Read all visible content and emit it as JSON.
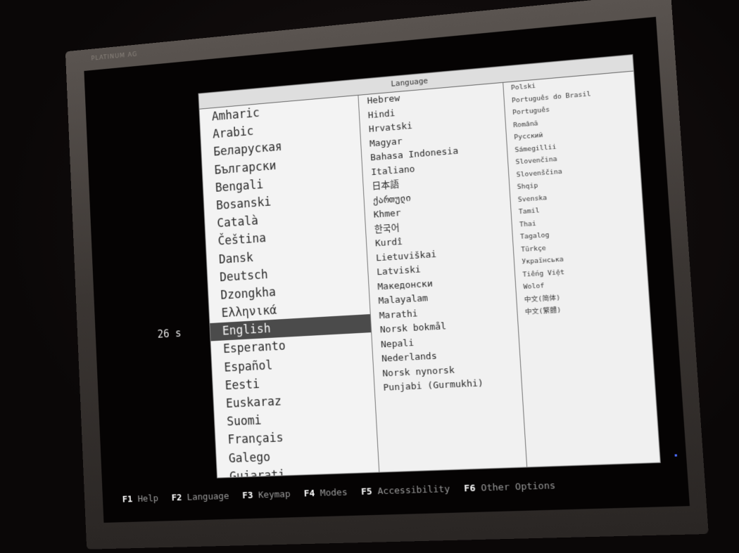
{
  "monitor": {
    "brand": "PLATINUM AG"
  },
  "boot": {
    "timer": "26 s"
  },
  "dialog": {
    "title": "Language",
    "columns": [
      [
        "Amharic",
        "Arabic",
        "Беларуская",
        "Български",
        "Bengali",
        "Bosanski",
        "Català",
        "Čeština",
        "Dansk",
        "Deutsch",
        "Dzongkha",
        "Ελληνικά",
        "English",
        "Esperanto",
        "Español",
        "Eesti",
        "Euskaraz",
        "Suomi",
        "Français",
        "Galego",
        "Gujarati"
      ],
      [
        "Hebrew",
        "Hindi",
        "Hrvatski",
        "Magyar",
        "Bahasa Indonesia",
        "Italiano",
        "日本語",
        "ქართული",
        "Khmer",
        "한국어",
        "Kurdî",
        "Lietuviškai",
        "Latviski",
        "Македонски",
        "Malayalam",
        "Marathi",
        "Norsk bokmål",
        "Nepali",
        "Nederlands",
        "Norsk nynorsk",
        "Punjabi (Gurmukhi)"
      ],
      [
        "Polski",
        "Português do Brasil",
        "Português",
        "Română",
        "Русский",
        "Sámegillii",
        "Slovenčina",
        "Slovenščina",
        "Shqip",
        "Svenska",
        "Tamil",
        "Thai",
        "Tagalog",
        "Türkçe",
        "Українська",
        "Tiếng Việt",
        "Wolof",
        "中文(简体)",
        "中文(繁體)"
      ]
    ],
    "selected": "English"
  },
  "footer": {
    "keys": [
      {
        "key": "F1",
        "label": "Help"
      },
      {
        "key": "F2",
        "label": "Language"
      },
      {
        "key": "F3",
        "label": "Keymap"
      },
      {
        "key": "F4",
        "label": "Modes"
      },
      {
        "key": "F5",
        "label": "Accessibility"
      },
      {
        "key": "F6",
        "label": "Other Options"
      }
    ]
  },
  "colors": {
    "selection": "#4b4b4b",
    "dialog_bg": "#e9e9e9",
    "screen_bg": "#050303"
  }
}
